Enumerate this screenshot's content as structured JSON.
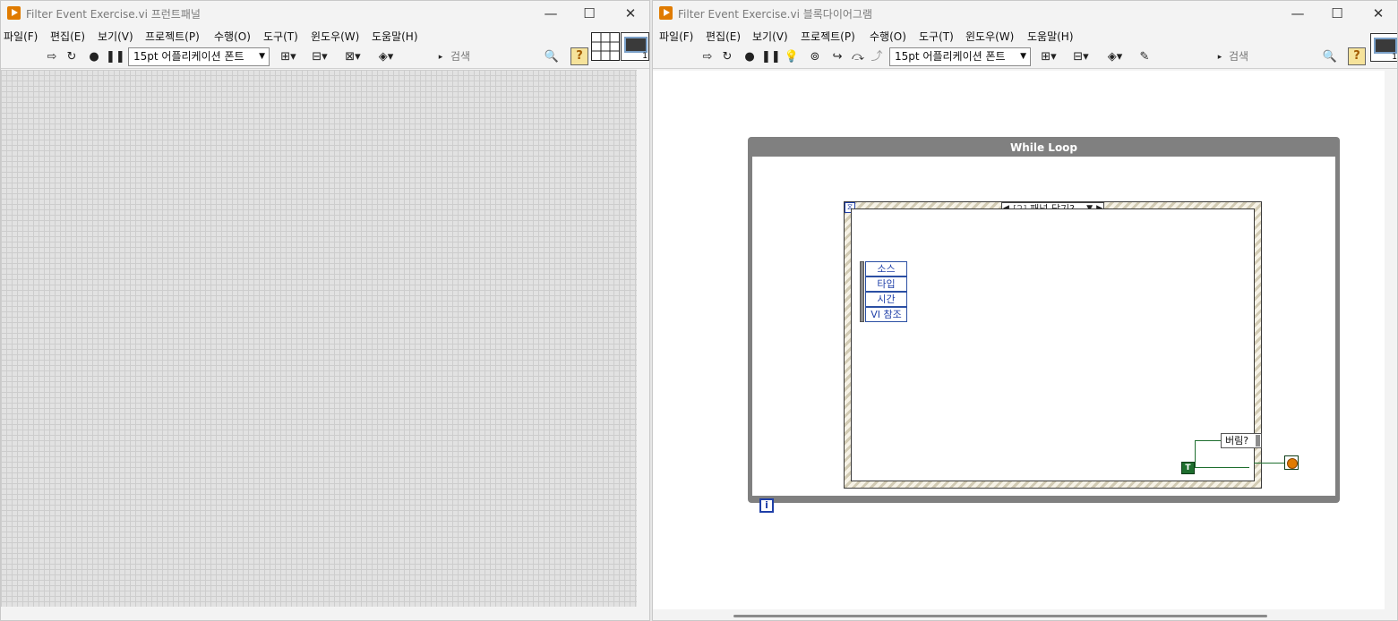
{
  "front_panel": {
    "title": "Filter Event Exercise.vi 프런트패널",
    "menus": [
      "파일(F)",
      "편집(E)",
      "보기(V)",
      "프로젝트(P)",
      "수행(O)",
      "도구(T)",
      "윈도우(W)",
      "도움말(H)"
    ],
    "font_dropdown": "15pt 어플리케이션 폰트",
    "search_placeholder": "검색",
    "connector_terminal_number": "1"
  },
  "block_diagram": {
    "title": "Filter Event Exercise.vi 블록다이어그램",
    "menus": [
      "파일(F)",
      "편집(E)",
      "보기(V)",
      "프로젝트(P)",
      "수행(O)",
      "도구(T)",
      "윈도우(W)",
      "도움말(H)"
    ],
    "font_dropdown": "15pt 어플리케이션 폰트",
    "search_placeholder": "검색",
    "connector_terminal_number": "1",
    "while_loop_label": "While Loop",
    "iteration_terminal": "i",
    "event_case_index": "[2]",
    "event_case_name": "패널 닫기?",
    "event_data_fields": [
      "소스",
      "타입",
      "시간",
      "VI 참조"
    ],
    "discard_label": "버림?",
    "true_constant": "T",
    "timeout_icon": "hourglass-icon"
  },
  "colors": {
    "labview_orange": "#e07b00",
    "while_loop_gray": "#808080",
    "boolean_green": "#1e6e2e",
    "terminal_blue": "#1f3fa8"
  }
}
